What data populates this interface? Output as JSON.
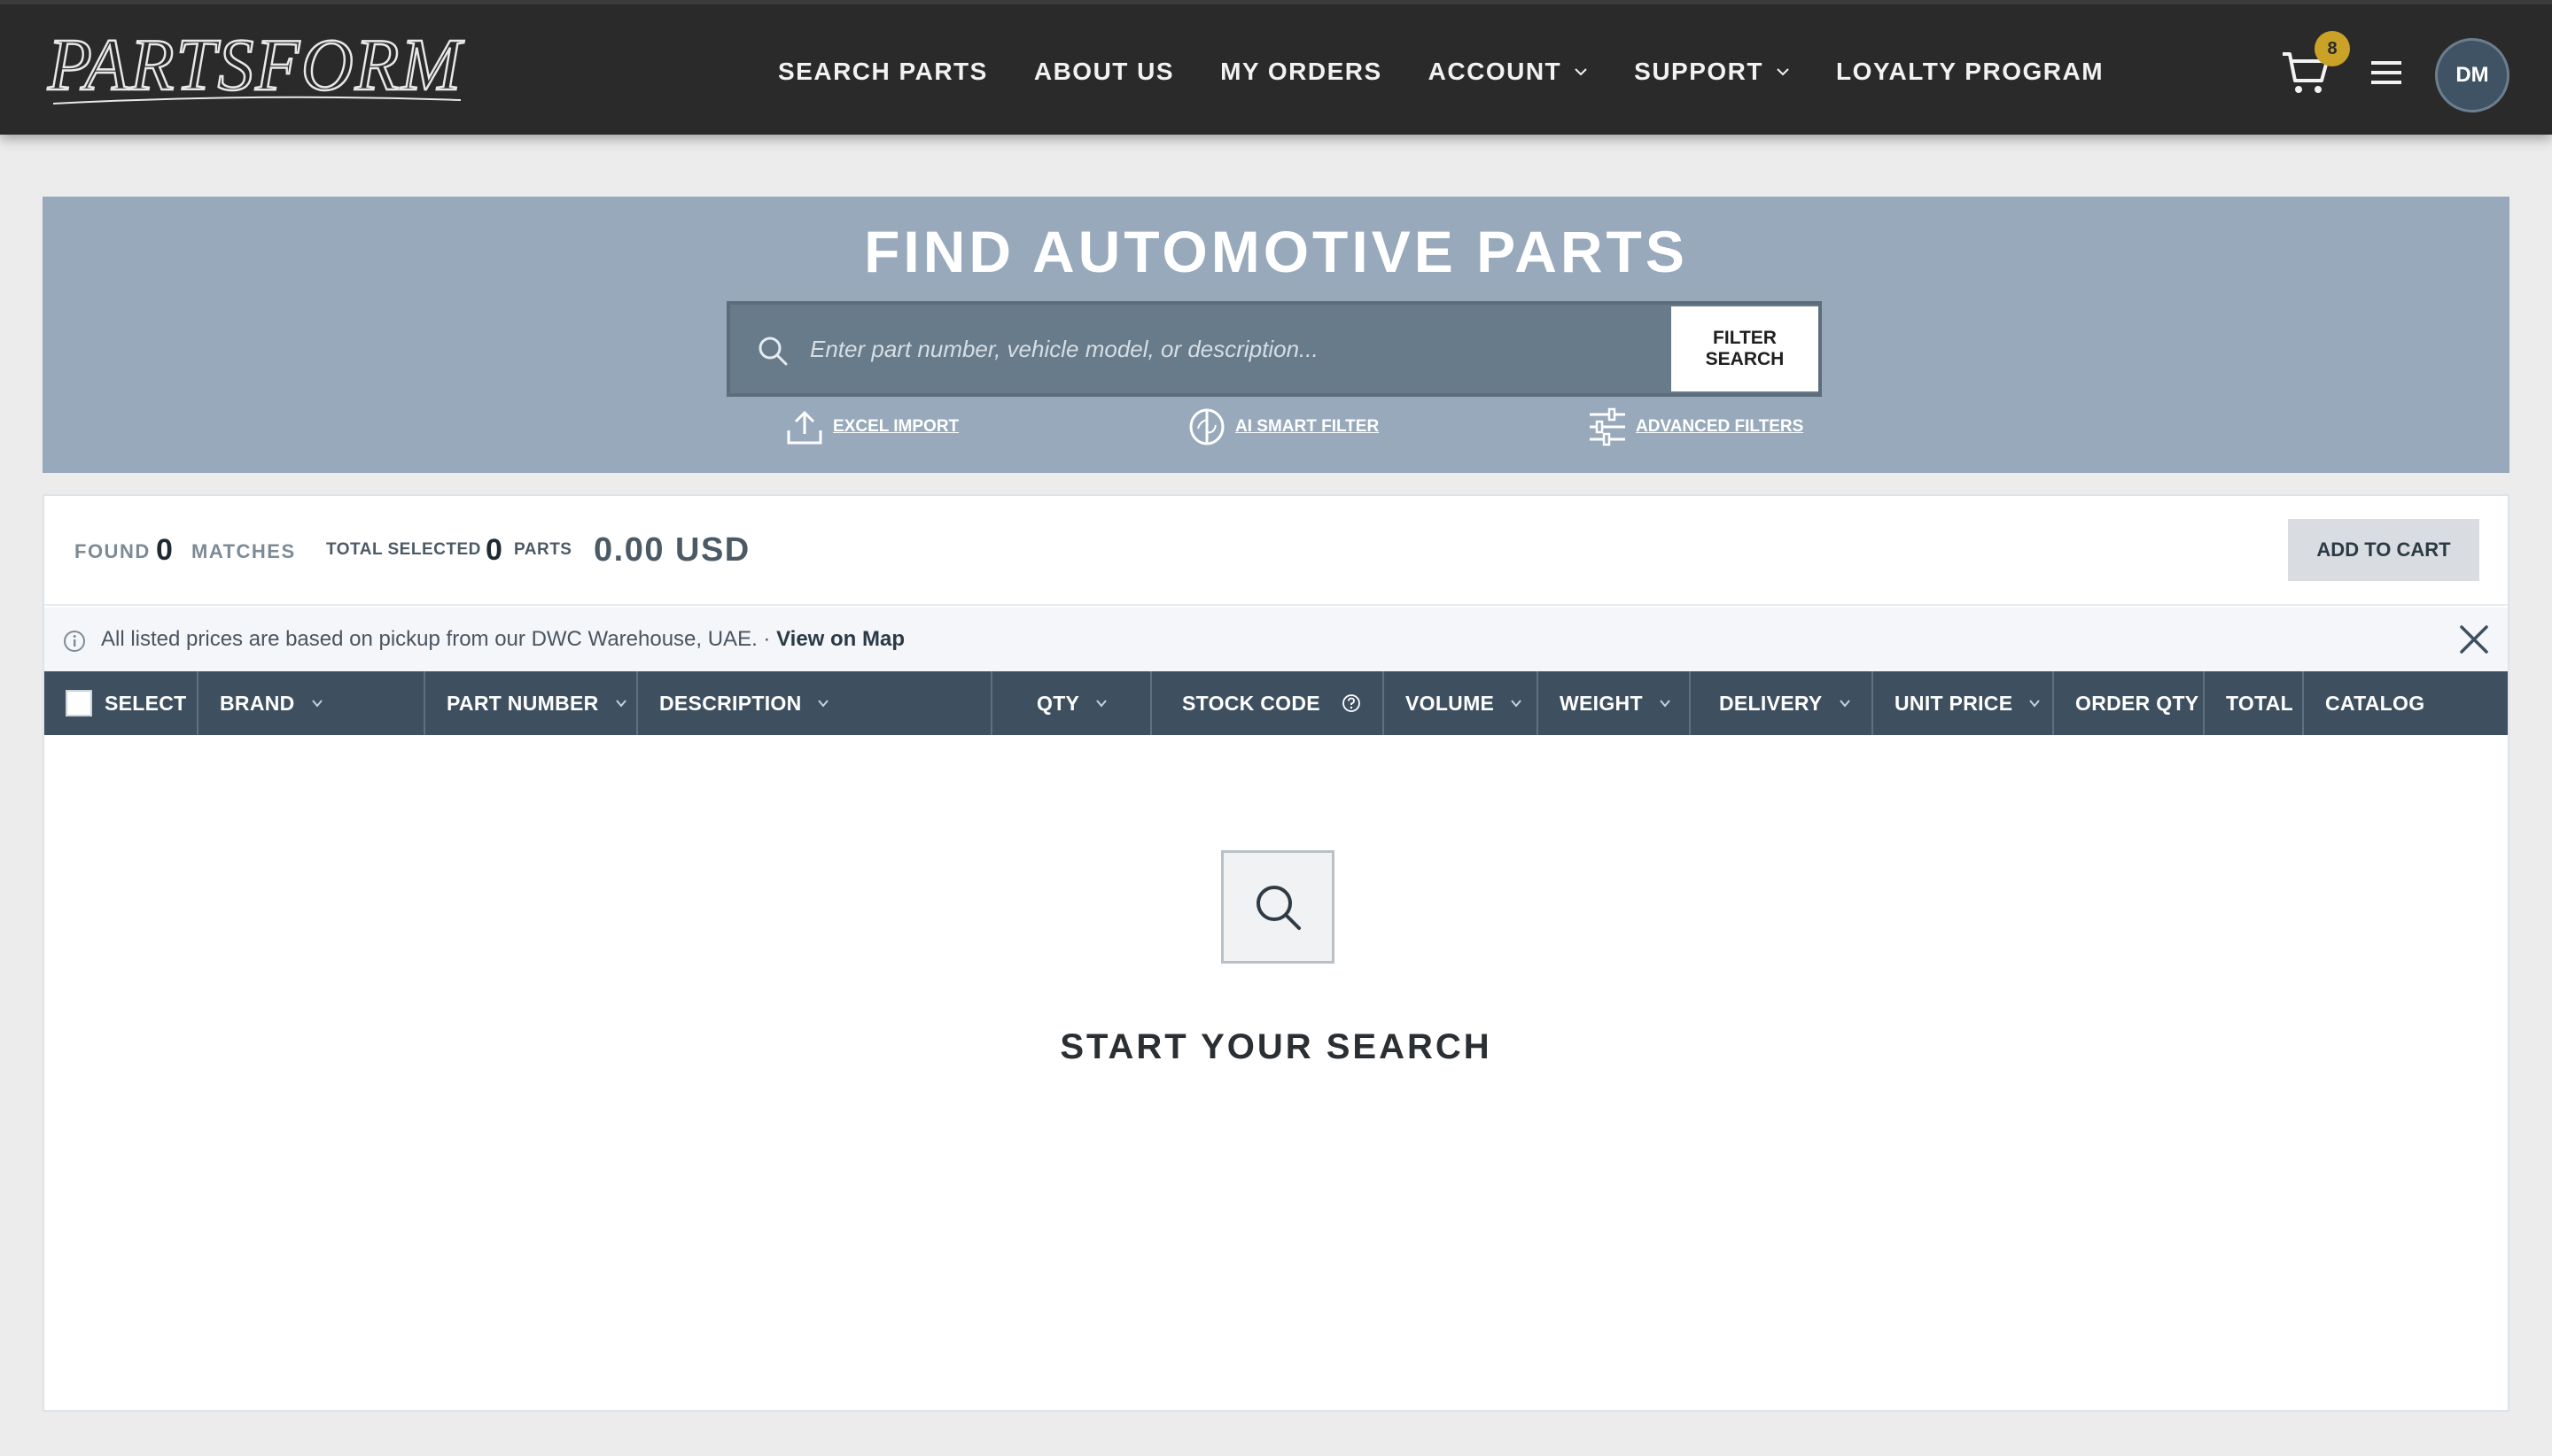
{
  "header": {
    "logo_text": "PARTSFORM",
    "nav": [
      {
        "label": "SEARCH PARTS"
      },
      {
        "label": "ABOUT US"
      },
      {
        "label": "MY ORDERS"
      },
      {
        "label": "ACCOUNT"
      },
      {
        "label": "SUPPORT"
      },
      {
        "label": "LOYALTY PROGRAM"
      }
    ],
    "cart_count": "8",
    "avatar_initials": "DM"
  },
  "hero": {
    "title": "FIND AUTOMOTIVE PARTS",
    "search_placeholder": "Enter part number, vehicle model, or description...",
    "filter_button": "FILTER SEARCH",
    "links": {
      "excel_import": "EXCEL IMPORT",
      "ai_smart_filter": "AI SMART FILTER",
      "advanced_filters": "ADVANCED FILTERS"
    }
  },
  "summary": {
    "found_label": "FOUND",
    "found_count": "0",
    "matches_label": "MATCHES",
    "total_selected_label": "TOTAL SELECTED",
    "selected_count": "0",
    "parts_label": "PARTS",
    "total_amount": "0.00 USD",
    "add_to_cart": "ADD TO CART"
  },
  "notice": {
    "text": "All listed prices are based on pickup from our DWC Warehouse, UAE. · ",
    "link": "View on Map"
  },
  "table": {
    "columns": [
      {
        "label": "SELECT"
      },
      {
        "label": "BRAND"
      },
      {
        "label": "PART NUMBER"
      },
      {
        "label": "DESCRIPTION"
      },
      {
        "label": "QTY"
      },
      {
        "label": "STOCK CODE"
      },
      {
        "label": "VOLUME"
      },
      {
        "label": "WEIGHT"
      },
      {
        "label": "DELIVERY"
      },
      {
        "label": "UNIT PRICE"
      },
      {
        "label": "ORDER QTY"
      },
      {
        "label": "TOTAL"
      },
      {
        "label": "CATALOG"
      }
    ]
  },
  "empty_state": {
    "title": "START YOUR SEARCH"
  },
  "colors": {
    "header_bg": "#2a2a2a",
    "hero_bg": "#97a9bb",
    "table_header_bg": "#3e5060",
    "badge": "#c9a227"
  }
}
